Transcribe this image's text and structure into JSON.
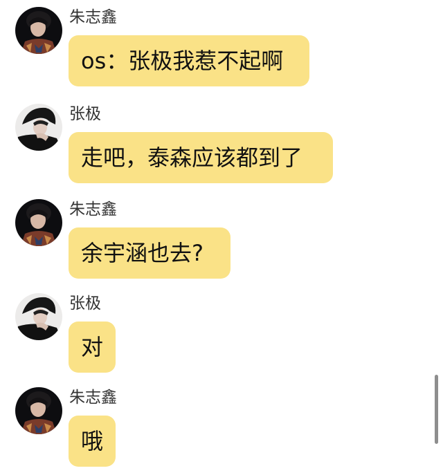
{
  "messages": [
    {
      "sender": "朱志鑫",
      "text": "os：张极我惹不起啊",
      "avatar_icon": "zhu-zhixin-avatar"
    },
    {
      "sender": "张极",
      "text": "走吧，泰森应该都到了",
      "avatar_icon": "zhang-ji-avatar"
    },
    {
      "sender": "朱志鑫",
      "text": "余宇涵也去?",
      "avatar_icon": "zhu-zhixin-avatar"
    },
    {
      "sender": "张极",
      "text": "对",
      "avatar_icon": "zhang-ji-avatar"
    },
    {
      "sender": "朱志鑫",
      "text": "哦",
      "avatar_icon": "zhu-zhixin-avatar"
    }
  ],
  "colors": {
    "bubble": "#fae287",
    "background": "#ffffff",
    "name_text": "#333333",
    "scrollbar": "#8e8e8e"
  }
}
